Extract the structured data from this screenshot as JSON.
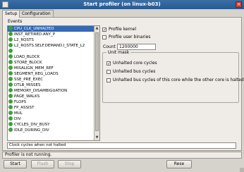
{
  "window": {
    "title": "Start profiler (on linux-b03)"
  },
  "tabs": [
    {
      "label": "Setup",
      "active": true
    },
    {
      "label": "Configuration",
      "active": false
    }
  ],
  "events": {
    "label": "Events",
    "items": [
      {
        "label": "CPU_CLK_UNHALTED",
        "selected": true
      },
      {
        "label": "INST_RETIRED.ANY_P"
      },
      {
        "label": "L2_RQSTS"
      },
      {
        "label": "L2_RQSTS.SELF.DEMAND.I_STATE_L2"
      },
      {
        "label": ""
      },
      {
        "label": "LOAD_BLOCK"
      },
      {
        "label": "STORE_BLOCK"
      },
      {
        "label": "MISALIGN_MEM_REF"
      },
      {
        "label": "SEGMENT_REG_LOADS"
      },
      {
        "label": "SSE_PRE_EXEC"
      },
      {
        "label": "DTLB_MISSES"
      },
      {
        "label": "MEMORY_DISAMBIGUATION"
      },
      {
        "label": "PAGE_WALKS"
      },
      {
        "label": "FLOPS"
      },
      {
        "label": "FP_ASSIST"
      },
      {
        "label": "MUL"
      },
      {
        "label": "DIV"
      },
      {
        "label": "CYCLES_DIV_BUSY"
      },
      {
        "label": "IDLE_DURING_DIV"
      }
    ],
    "description": "Clock cycles when not halted"
  },
  "options": {
    "profile_kernel": {
      "label": "Profile kernel",
      "checked": true
    },
    "profile_user": {
      "label": "Profile user binaries",
      "checked": false
    },
    "count_label": "Count",
    "count_value": "1200000"
  },
  "unit_mask": {
    "legend": "Unit mask",
    "items": [
      {
        "label": "Unhalted core cycles",
        "checked": true
      },
      {
        "label": "Unhalted bus cycles",
        "checked": false
      },
      {
        "label": "Unhalted bus cycles of this core while the other core is halted",
        "checked": false
      }
    ]
  },
  "status": "Profiler is not running.",
  "buttons": {
    "start": "Start",
    "flush": "Flush",
    "stop": "Stop",
    "reset": "Rese"
  },
  "colors": {
    "selection": "#3469b5",
    "event_dot": "#3aa339",
    "titlebar": "#3a6ea5"
  }
}
